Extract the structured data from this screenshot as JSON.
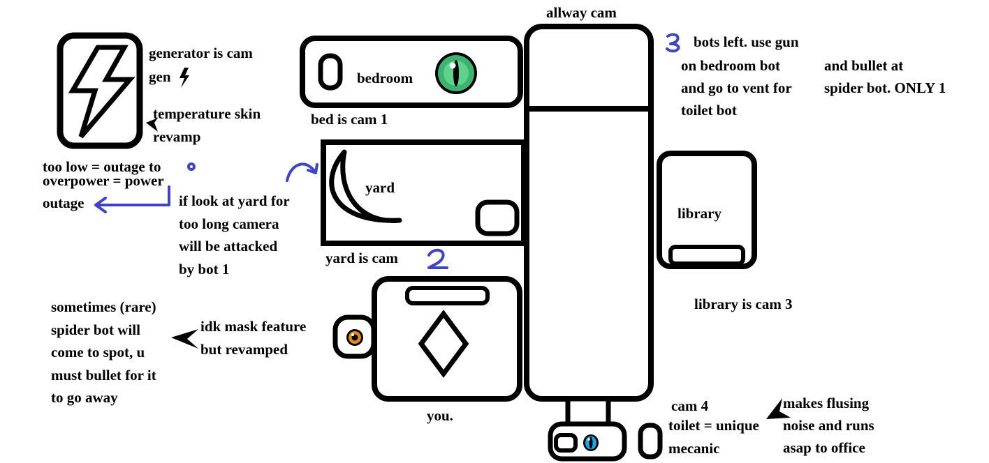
{
  "colors": {
    "ink": "#000000",
    "annotation_blue": "#3d44c8",
    "green_eye": "#3cb371",
    "cyan_eye": "#1aa9e6",
    "orange_eye": "#e28a1c"
  },
  "rooms": {
    "hallway_title": "allway cam",
    "bedroom": "bedroom",
    "bedroom_caption": "bed is cam 1",
    "yard": "yard",
    "yard_caption": "yard is cam",
    "library": "library",
    "library_caption": "library is cam 3",
    "office_caption": "you.",
    "toilet_lines": [
      "cam 4",
      "toilet = unique",
      "mecanic"
    ]
  },
  "notes": {
    "generator": [
      "generator is cam",
      "gen"
    ],
    "temperature": [
      "temperature skin",
      "revamp"
    ],
    "too_low": "too low = outage to",
    "overpower": [
      "overpower = power",
      "outage"
    ],
    "yard_attack": [
      "if look at yard for",
      "too long camera",
      "will be attacked",
      "by bot 1"
    ],
    "spider": [
      "sometimes (rare)",
      "spider bot will",
      "come to spot, u",
      "must bullet for it",
      "to go away"
    ],
    "mask": [
      "idk mask feature",
      "but revamped"
    ],
    "bots_left": [
      "bots left. use gun",
      "on bedroom bot",
      "and go to vent for",
      "toilet bot"
    ],
    "bullet": [
      "and bullet at",
      "spider bot. ONLY 1"
    ],
    "flushing": [
      "makes flusing",
      "noise and runs",
      "asap to office"
    ]
  },
  "handwritten": {
    "two": "2",
    "three": "3"
  },
  "icons": [
    "lightning-bolt-icon",
    "green-eye-icon",
    "moon-icon",
    "diamond-icon",
    "orange-eye-icon",
    "cyan-eye-icon",
    "arrow-left-icon",
    "curved-arrow-icon"
  ]
}
